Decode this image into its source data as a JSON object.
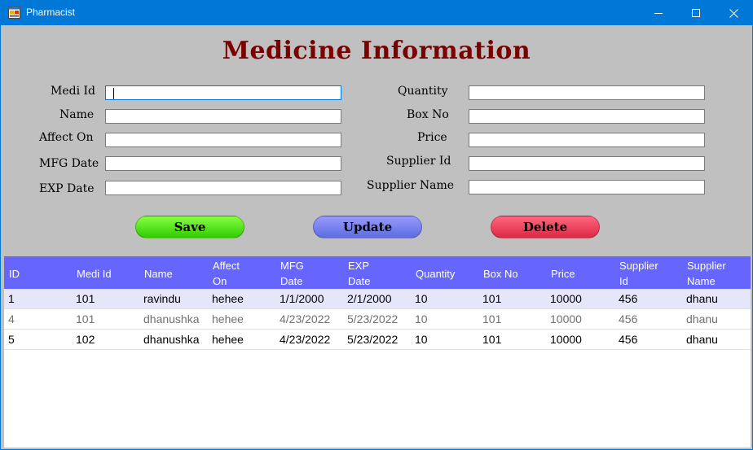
{
  "window": {
    "title": "Pharmacist"
  },
  "form": {
    "heading": "Medicine Information",
    "left_labels": [
      "Medi Id",
      "Name",
      "Affect On",
      "MFG Date",
      "EXP Date"
    ],
    "right_labels": [
      "Quantity",
      "Box No",
      "Price",
      "Supplier Id",
      "Supplier Name"
    ],
    "values": {
      "medi_id": "",
      "name": "",
      "affect_on": "",
      "mfg_date": "",
      "exp_date": "",
      "quantity": "",
      "box_no": "",
      "price": "",
      "supplier_id": "",
      "supplier_name": ""
    }
  },
  "buttons": {
    "save": "Save",
    "update": "Update",
    "delete": "Delete"
  },
  "colors": {
    "heading": "#7a0000",
    "grid_header": "#6666ff",
    "save_gradient": [
      "#88ff44",
      "#2ecc00"
    ],
    "update_gradient": [
      "#9999ff",
      "#5a6ee0"
    ],
    "delete_gradient": [
      "#ff6680",
      "#dc2844"
    ]
  },
  "table": {
    "columns": [
      {
        "line1": "ID",
        "line2": ""
      },
      {
        "line1": "Medi Id",
        "line2": ""
      },
      {
        "line1": "Name",
        "line2": ""
      },
      {
        "line1": "Affect",
        "line2": "On"
      },
      {
        "line1": "MFG",
        "line2": "Date"
      },
      {
        "line1": "EXP",
        "line2": "Date"
      },
      {
        "line1": "Quantity",
        "line2": ""
      },
      {
        "line1": "Box No",
        "line2": ""
      },
      {
        "line1": "Price",
        "line2": ""
      },
      {
        "line1": "Supplier",
        "line2": "Id"
      },
      {
        "line1": "Supplier",
        "line2": "Name"
      }
    ],
    "rows": [
      [
        "1",
        "101",
        "ravindu",
        "hehee",
        "1/1/2000",
        "2/1/2000",
        "10",
        "101",
        "10000",
        "456",
        "dhanu"
      ],
      [
        "4",
        "101",
        "dhanushka",
        "hehee",
        "4/23/2022",
        "5/23/2022",
        "10",
        "101",
        "10000",
        "456",
        "dhanu"
      ],
      [
        "5",
        "102",
        "dhanushka",
        "hehee",
        "4/23/2022",
        "5/23/2022",
        "10",
        "101",
        "10000",
        "456",
        "dhanu"
      ]
    ]
  }
}
